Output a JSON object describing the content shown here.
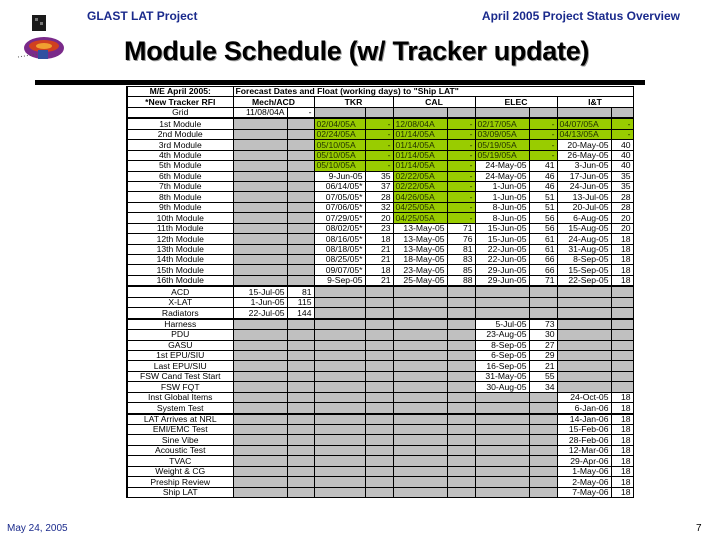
{
  "header": {
    "project": "GLAST LAT Project",
    "report": "April 2005 Project Status Overview"
  },
  "title": "Module Schedule (w/ Tracker update)",
  "footer": {
    "date": "May 24, 2005",
    "page": "7"
  },
  "colors": {
    "complete_green": "#99cc00",
    "na_grey": "#c0c0c0",
    "header_blue": "#1a2a8c"
  },
  "table": {
    "corner_line1": "M/E April 2005:",
    "corner_line2": "*New Tracker RFI",
    "span_header": "Forecast Dates and Float (working days) to \"Ship LAT\"",
    "groups": [
      "Mech/ACD",
      "TKR",
      "CAL",
      "ELEC",
      "I&T"
    ],
    "rows": [
      {
        "label": "Grid",
        "cells": [
          [
            "11/08/04A",
            "-",
            "w"
          ],
          [
            "",
            "",
            "g"
          ],
          [
            "",
            "",
            "g"
          ],
          [
            "",
            "",
            "g"
          ],
          [
            "",
            "",
            "g"
          ]
        ]
      },
      {
        "label": "1st Module",
        "cells": [
          [
            "",
            "",
            "g"
          ],
          [
            "02/04/05A",
            "-",
            "G"
          ],
          [
            "12/08/04A",
            "-",
            "G"
          ],
          [
            "02/17/05A",
            "-",
            "G"
          ],
          [
            "04/07/05A",
            "-",
            "G"
          ]
        ]
      },
      {
        "label": "2nd Module",
        "cells": [
          [
            "",
            "",
            "g"
          ],
          [
            "02/24/05A",
            "-",
            "G"
          ],
          [
            "01/14/05A",
            "-",
            "G"
          ],
          [
            "03/09/05A",
            "-",
            "G"
          ],
          [
            "04/13/05A",
            "-",
            "G"
          ]
        ]
      },
      {
        "label": "3rd Module",
        "cells": [
          [
            "",
            "",
            "g"
          ],
          [
            "05/10/05A",
            "-",
            "G"
          ],
          [
            "01/14/05A",
            "-",
            "G"
          ],
          [
            "05/19/05A",
            "-",
            "G"
          ],
          [
            "20-May-05",
            "40",
            "w"
          ]
        ]
      },
      {
        "label": "4th Module",
        "cells": [
          [
            "",
            "",
            "g"
          ],
          [
            "05/10/05A",
            "-",
            "G"
          ],
          [
            "01/14/05A",
            "-",
            "G"
          ],
          [
            "05/19/05A",
            "-",
            "G"
          ],
          [
            "26-May-05",
            "40",
            "w"
          ]
        ]
      },
      {
        "label": "5th Module",
        "cells": [
          [
            "",
            "",
            "g"
          ],
          [
            "05/10/05A",
            "-",
            "G"
          ],
          [
            "01/14/05A",
            "-",
            "G"
          ],
          [
            "24-May-05",
            "41",
            "w"
          ],
          [
            "3-Jun-05",
            "40",
            "w"
          ]
        ]
      },
      {
        "label": "6th Module",
        "cells": [
          [
            "",
            "",
            "g"
          ],
          [
            "9-Jun-05",
            "35",
            "w"
          ],
          [
            "02/22/05A",
            "-",
            "G"
          ],
          [
            "24-May-05",
            "46",
            "w"
          ],
          [
            "17-Jun-05",
            "35",
            "w"
          ]
        ]
      },
      {
        "label": "7th Module",
        "cells": [
          [
            "",
            "",
            "g"
          ],
          [
            "06/14/05*",
            "37",
            "w"
          ],
          [
            "02/22/05A",
            "-",
            "G"
          ],
          [
            "1-Jun-05",
            "46",
            "w"
          ],
          [
            "24-Jun-05",
            "35",
            "w"
          ]
        ]
      },
      {
        "label": "8th Module",
        "cells": [
          [
            "",
            "",
            "g"
          ],
          [
            "07/05/05*",
            "28",
            "w"
          ],
          [
            "04/26/05A",
            "-",
            "G"
          ],
          [
            "1-Jun-05",
            "51",
            "w"
          ],
          [
            "13-Jul-05",
            "28",
            "w"
          ]
        ]
      },
      {
        "label": "9th Module",
        "cells": [
          [
            "",
            "",
            "g"
          ],
          [
            "07/06/05*",
            "32",
            "w"
          ],
          [
            "04/25/05A",
            "-",
            "G"
          ],
          [
            "8-Jun-05",
            "51",
            "w"
          ],
          [
            "20-Jul-05",
            "28",
            "w"
          ]
        ]
      },
      {
        "label": "10th Module",
        "cells": [
          [
            "",
            "",
            "g"
          ],
          [
            "07/29/05*",
            "20",
            "w"
          ],
          [
            "04/25/05A",
            "-",
            "G"
          ],
          [
            "8-Jun-05",
            "56",
            "w"
          ],
          [
            "6-Aug-05",
            "20",
            "w"
          ]
        ]
      },
      {
        "label": "11th Module",
        "cells": [
          [
            "",
            "",
            "g"
          ],
          [
            "08/02/05*",
            "23",
            "w"
          ],
          [
            "13-May-05",
            "71",
            "w"
          ],
          [
            "15-Jun-05",
            "56",
            "w"
          ],
          [
            "15-Aug-05",
            "20",
            "w"
          ]
        ]
      },
      {
        "label": "12th Module",
        "cells": [
          [
            "",
            "",
            "g"
          ],
          [
            "08/16/05*",
            "18",
            "w"
          ],
          [
            "13-May-05",
            "76",
            "w"
          ],
          [
            "15-Jun-05",
            "61",
            "w"
          ],
          [
            "24-Aug-05",
            "18",
            "w"
          ]
        ]
      },
      {
        "label": "13th Module",
        "cells": [
          [
            "",
            "",
            "g"
          ],
          [
            "08/18/05*",
            "21",
            "w"
          ],
          [
            "13-May-05",
            "81",
            "w"
          ],
          [
            "22-Jun-05",
            "61",
            "w"
          ],
          [
            "31-Aug-05",
            "18",
            "w"
          ]
        ]
      },
      {
        "label": "14th Module",
        "cells": [
          [
            "",
            "",
            "g"
          ],
          [
            "08/25/05*",
            "21",
            "w"
          ],
          [
            "18-May-05",
            "83",
            "w"
          ],
          [
            "22-Jun-05",
            "66",
            "w"
          ],
          [
            "8-Sep-05",
            "18",
            "w"
          ]
        ]
      },
      {
        "label": "15th Module",
        "cells": [
          [
            "",
            "",
            "g"
          ],
          [
            "09/07/05*",
            "18",
            "w"
          ],
          [
            "23-May-05",
            "85",
            "w"
          ],
          [
            "29-Jun-05",
            "66",
            "w"
          ],
          [
            "15-Sep-05",
            "18",
            "w"
          ]
        ]
      },
      {
        "label": "16th Module",
        "cells": [
          [
            "",
            "",
            "g"
          ],
          [
            "9-Sep-05",
            "21",
            "w"
          ],
          [
            "25-May-05",
            "88",
            "w"
          ],
          [
            "29-Jun-05",
            "71",
            "w"
          ],
          [
            "22-Sep-05",
            "18",
            "w"
          ]
        ]
      },
      {
        "label": "ACD",
        "cells": [
          [
            "15-Jul-05",
            "81",
            "w"
          ],
          [
            "",
            "",
            "g"
          ],
          [
            "",
            "",
            "g"
          ],
          [
            "",
            "",
            "g"
          ],
          [
            "",
            "",
            "g"
          ]
        ]
      },
      {
        "label": "X-LAT",
        "cells": [
          [
            "1-Jun-05",
            "115",
            "w"
          ],
          [
            "",
            "",
            "g"
          ],
          [
            "",
            "",
            "g"
          ],
          [
            "",
            "",
            "g"
          ],
          [
            "",
            "",
            "g"
          ]
        ]
      },
      {
        "label": "Radiators",
        "cells": [
          [
            "22-Jul-05",
            "144",
            "w"
          ],
          [
            "",
            "",
            "g"
          ],
          [
            "",
            "",
            "g"
          ],
          [
            "",
            "",
            "g"
          ],
          [
            "",
            "",
            "g"
          ]
        ]
      },
      {
        "label": "Harness",
        "cells": [
          [
            "",
            "",
            "g"
          ],
          [
            "",
            "",
            "g"
          ],
          [
            "",
            "",
            "g"
          ],
          [
            "5-Jul-05",
            "73",
            "w"
          ],
          [
            "",
            "",
            "g"
          ]
        ]
      },
      {
        "label": "PDU",
        "cells": [
          [
            "",
            "",
            "g"
          ],
          [
            "",
            "",
            "g"
          ],
          [
            "",
            "",
            "g"
          ],
          [
            "23-Aug-05",
            "30",
            "w"
          ],
          [
            "",
            "",
            "g"
          ]
        ]
      },
      {
        "label": "GASU",
        "cells": [
          [
            "",
            "",
            "g"
          ],
          [
            "",
            "",
            "g"
          ],
          [
            "",
            "",
            "g"
          ],
          [
            "8-Sep-05",
            "27",
            "w"
          ],
          [
            "",
            "",
            "g"
          ]
        ]
      },
      {
        "label": "1st EPU/SIU",
        "cells": [
          [
            "",
            "",
            "g"
          ],
          [
            "",
            "",
            "g"
          ],
          [
            "",
            "",
            "g"
          ],
          [
            "6-Sep-05",
            "29",
            "w"
          ],
          [
            "",
            "",
            "g"
          ]
        ]
      },
      {
        "label": "Last EPU/SIU",
        "cells": [
          [
            "",
            "",
            "g"
          ],
          [
            "",
            "",
            "g"
          ],
          [
            "",
            "",
            "g"
          ],
          [
            "16-Sep-05",
            "21",
            "w"
          ],
          [
            "",
            "",
            "g"
          ]
        ]
      },
      {
        "label": "FSW Cand Test Start",
        "cells": [
          [
            "",
            "",
            "g"
          ],
          [
            "",
            "",
            "g"
          ],
          [
            "",
            "",
            "g"
          ],
          [
            "31-May-05",
            "55",
            "w"
          ],
          [
            "",
            "",
            "g"
          ]
        ]
      },
      {
        "label": "FSW FQT",
        "cells": [
          [
            "",
            "",
            "g"
          ],
          [
            "",
            "",
            "g"
          ],
          [
            "",
            "",
            "g"
          ],
          [
            "30-Aug-05",
            "34",
            "w"
          ],
          [
            "",
            "",
            "g"
          ]
        ]
      },
      {
        "label": "Inst Global Items",
        "cells": [
          [
            "",
            "",
            "g"
          ],
          [
            "",
            "",
            "g"
          ],
          [
            "",
            "",
            "g"
          ],
          [
            "",
            "",
            "g"
          ],
          [
            "24-Oct-05",
            "18",
            "w"
          ]
        ]
      },
      {
        "label": "System Test",
        "cells": [
          [
            "",
            "",
            "g"
          ],
          [
            "",
            "",
            "g"
          ],
          [
            "",
            "",
            "g"
          ],
          [
            "",
            "",
            "g"
          ],
          [
            "6-Jan-06",
            "18",
            "w"
          ]
        ]
      },
      {
        "label": "LAT Arrives at NRL",
        "cells": [
          [
            "",
            "",
            "g"
          ],
          [
            "",
            "",
            "g"
          ],
          [
            "",
            "",
            "g"
          ],
          [
            "",
            "",
            "g"
          ],
          [
            "14-Jan-06",
            "18",
            "w"
          ]
        ]
      },
      {
        "label": "EMI/EMC Test",
        "cells": [
          [
            "",
            "",
            "g"
          ],
          [
            "",
            "",
            "g"
          ],
          [
            "",
            "",
            "g"
          ],
          [
            "",
            "",
            "g"
          ],
          [
            "15-Feb-06",
            "18",
            "w"
          ]
        ]
      },
      {
        "label": "Sine Vibe",
        "cells": [
          [
            "",
            "",
            "g"
          ],
          [
            "",
            "",
            "g"
          ],
          [
            "",
            "",
            "g"
          ],
          [
            "",
            "",
            "g"
          ],
          [
            "28-Feb-06",
            "18",
            "w"
          ]
        ]
      },
      {
        "label": "Acoustic Test",
        "cells": [
          [
            "",
            "",
            "g"
          ],
          [
            "",
            "",
            "g"
          ],
          [
            "",
            "",
            "g"
          ],
          [
            "",
            "",
            "g"
          ],
          [
            "12-Mar-06",
            "18",
            "w"
          ]
        ]
      },
      {
        "label": "TVAC",
        "cells": [
          [
            "",
            "",
            "g"
          ],
          [
            "",
            "",
            "g"
          ],
          [
            "",
            "",
            "g"
          ],
          [
            "",
            "",
            "g"
          ],
          [
            "29-Apr-06",
            "18",
            "w"
          ]
        ]
      },
      {
        "label": "Weight & CG",
        "cells": [
          [
            "",
            "",
            "g"
          ],
          [
            "",
            "",
            "g"
          ],
          [
            "",
            "",
            "g"
          ],
          [
            "",
            "",
            "g"
          ],
          [
            "1-May-06",
            "18",
            "w"
          ]
        ]
      },
      {
        "label": "Preship Review",
        "cells": [
          [
            "",
            "",
            "g"
          ],
          [
            "",
            "",
            "g"
          ],
          [
            "",
            "",
            "g"
          ],
          [
            "",
            "",
            "g"
          ],
          [
            "2-May-06",
            "18",
            "w"
          ]
        ]
      },
      {
        "label": "Ship LAT",
        "cells": [
          [
            "",
            "",
            "g"
          ],
          [
            "",
            "",
            "g"
          ],
          [
            "",
            "",
            "g"
          ],
          [
            "",
            "",
            "g"
          ],
          [
            "7-May-06",
            "18",
            "w"
          ]
        ]
      }
    ]
  }
}
